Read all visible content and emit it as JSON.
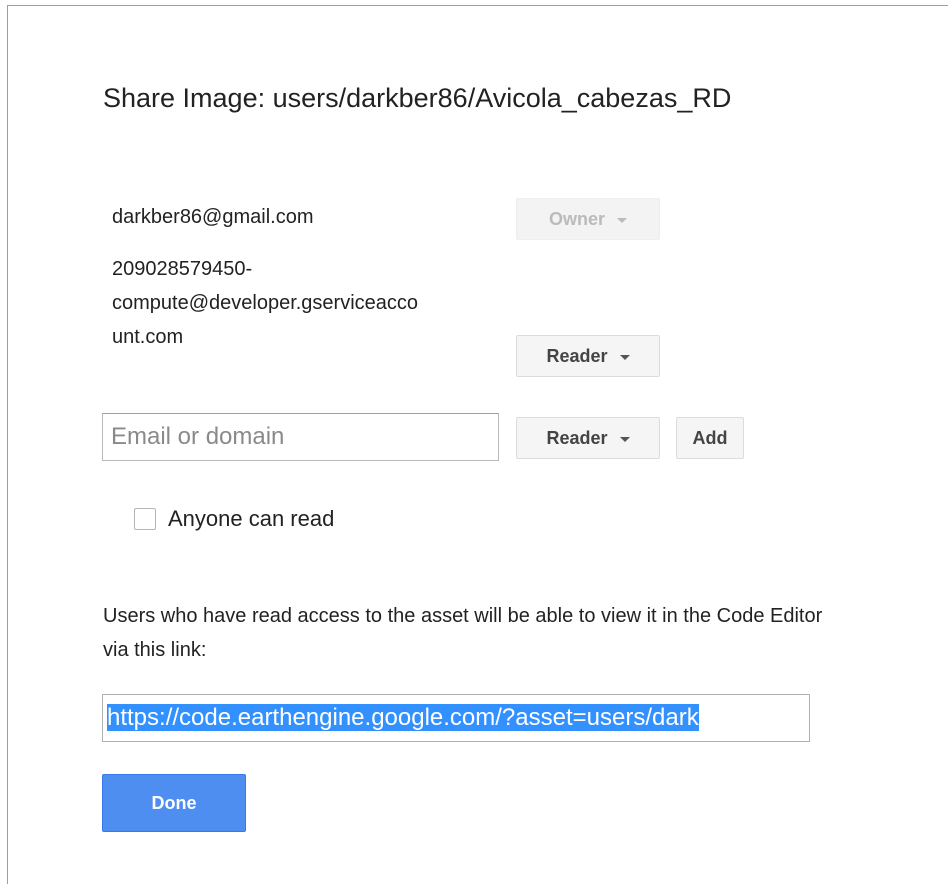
{
  "dialog": {
    "title": "Share Image: users/darkber86/Avicola_cabezas_RD"
  },
  "principals": [
    {
      "email": "darkber86@gmail.com",
      "role": "Owner"
    },
    {
      "email": "209028579450-\ncompute@developer.gserviceacco\nunt.com",
      "role": "Reader"
    }
  ],
  "add_row": {
    "placeholder": "Email or domain",
    "role": "Reader",
    "add_label": "Add"
  },
  "anyone_can_read": {
    "label": "Anyone can read",
    "checked": false
  },
  "info_text": "Users who have read access to the asset will be able to view it in the Code Editor via this link:",
  "link": "https://code.earthengine.google.com/?asset=users/dark",
  "done_label": "Done",
  "colors": {
    "primary_button": "#4d8ef0",
    "selection_highlight": "#3390ff"
  }
}
